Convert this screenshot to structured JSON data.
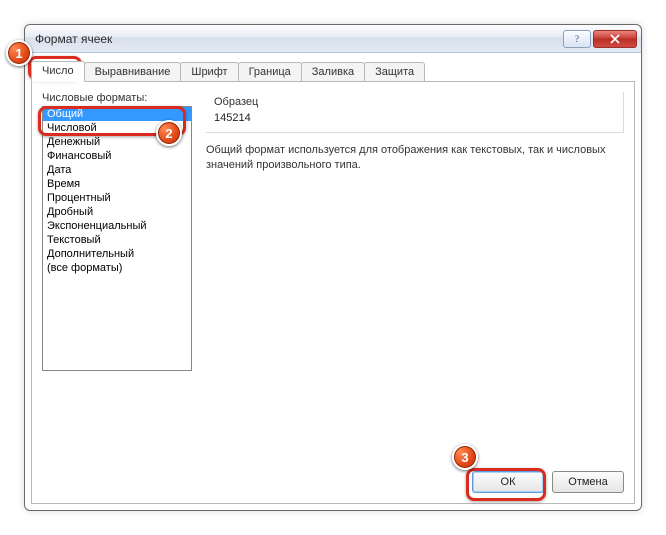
{
  "window": {
    "title": "Формат ячеек"
  },
  "tabs": [
    {
      "label": "Число"
    },
    {
      "label": "Выравнивание"
    },
    {
      "label": "Шрифт"
    },
    {
      "label": "Граница"
    },
    {
      "label": "Заливка"
    },
    {
      "label": "Защита"
    }
  ],
  "left": {
    "caption": "Числовые форматы:",
    "items": [
      "Общий",
      "Числовой",
      "Денежный",
      "Финансовый",
      "Дата",
      "Время",
      "Процентный",
      "Дробный",
      "Экспоненциальный",
      "Текстовый",
      "Дополнительный",
      "(все форматы)"
    ],
    "selected_index": 0
  },
  "right": {
    "sample_label": "Образец",
    "sample_value": "145214",
    "description": "Общий формат используется для отображения как текстовых, так и числовых значений произвольного типа."
  },
  "buttons": {
    "ok": "ОК",
    "cancel": "Отмена"
  },
  "annotations": {
    "b1": "1",
    "b2": "2",
    "b3": "3"
  }
}
